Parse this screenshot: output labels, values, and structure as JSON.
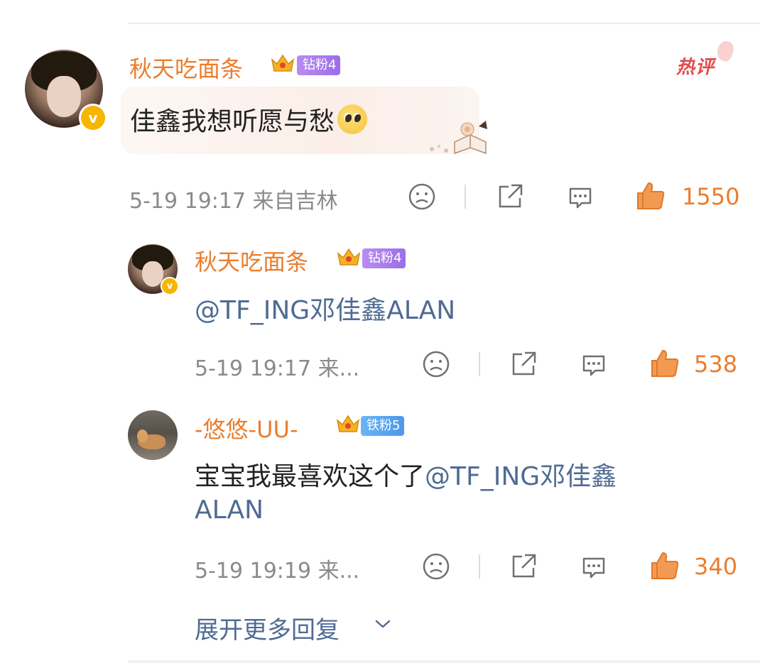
{
  "hot_label": "热评",
  "comment": {
    "username": "秋天吃面条",
    "fan_badge": "钻粉4",
    "text": "佳鑫我想听愿与愁",
    "emoji": "pleading-face-emoji",
    "timestamp": "5-19 19:17 来自吉林",
    "likes": "1550"
  },
  "replies": [
    {
      "username": "秋天吃面条",
      "fan_badge": "钻粉4",
      "text_mention": "@TF_ING邓佳鑫ALAN",
      "timestamp": "5-19 19:17 来...",
      "likes": "538"
    },
    {
      "username": "-悠悠-UU-",
      "fan_badge": "铁粉5",
      "text_plain": "宝宝我最喜欢这个了",
      "text_mention_line1": "@TF_ING邓佳鑫",
      "text_mention_line2": "ALAN",
      "timestamp": "5-19 19:19 来...",
      "likes": "340"
    }
  ],
  "expand_more": "展开更多回复",
  "colors": {
    "username": "#eb7d2e",
    "mention": "#4f6b93",
    "like": "#eb7d2e",
    "meta": "#8a8a8a",
    "hot": "#e24b4b"
  },
  "icons": [
    "verified-v-icon",
    "crown-icon",
    "dislike-face-icon",
    "share-icon",
    "comment-icon",
    "thumbs-up-icon",
    "chevron-down-icon"
  ]
}
